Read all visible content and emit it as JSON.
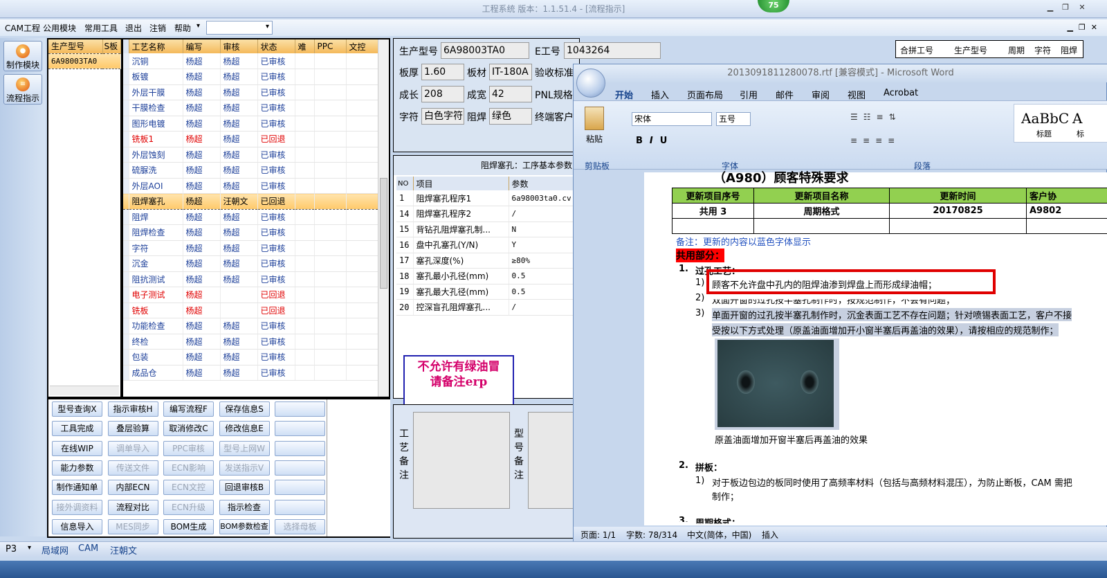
{
  "app": {
    "title": "工程系统  版本：1.1.51.4 - [流程指示]",
    "badge": "75"
  },
  "menu": {
    "items": [
      "CAM工程",
      "公用模块",
      "常用工具",
      "退出",
      "注销",
      "帮助"
    ],
    "dropdown_arrow": "▾",
    "combo_value": ""
  },
  "side_nav": [
    {
      "label": "制作模块"
    },
    {
      "label": "流程指示"
    }
  ],
  "model_list": {
    "headers": [
      "生产型号",
      "S板"
    ],
    "rows": [
      "6A98003TA0"
    ]
  },
  "process_grid": {
    "headers": [
      "工艺名称",
      "编写",
      "审核",
      "状态",
      "难",
      "PPC",
      "文控"
    ],
    "rows": [
      {
        "name": "沉铜",
        "writer": "杨超",
        "reviewer": "杨超",
        "status": "已审核",
        "red": false
      },
      {
        "name": "板镀",
        "writer": "杨超",
        "reviewer": "杨超",
        "status": "已审核",
        "red": false
      },
      {
        "name": "外层干膜",
        "writer": "杨超",
        "reviewer": "杨超",
        "status": "已审核",
        "red": false
      },
      {
        "name": "干膜检查",
        "writer": "杨超",
        "reviewer": "杨超",
        "status": "已审核",
        "red": false
      },
      {
        "name": "图形电镀",
        "writer": "杨超",
        "reviewer": "杨超",
        "status": "已审核",
        "red": false
      },
      {
        "name": "铣板1",
        "writer": "杨超",
        "reviewer": "杨超",
        "status": "已回退",
        "red": true
      },
      {
        "name": "外层蚀刻",
        "writer": "杨超",
        "reviewer": "杨超",
        "status": "已审核",
        "red": false
      },
      {
        "name": "硫脲洗",
        "writer": "杨超",
        "reviewer": "杨超",
        "status": "已审核",
        "red": false
      },
      {
        "name": "外层AOI",
        "writer": "杨超",
        "reviewer": "杨超",
        "status": "已审核",
        "red": false
      },
      {
        "name": "阻焊塞孔",
        "writer": "杨超",
        "reviewer": "汪朝文",
        "status": "已回退",
        "red": false,
        "selected": true
      },
      {
        "name": "阻焊",
        "writer": "杨超",
        "reviewer": "杨超",
        "status": "已审核",
        "red": false
      },
      {
        "name": "阻焊检查",
        "writer": "杨超",
        "reviewer": "杨超",
        "status": "已审核",
        "red": false
      },
      {
        "name": "字符",
        "writer": "杨超",
        "reviewer": "杨超",
        "status": "已审核",
        "red": false
      },
      {
        "name": "沉金",
        "writer": "杨超",
        "reviewer": "杨超",
        "status": "已审核",
        "red": false
      },
      {
        "name": "阻抗测试",
        "writer": "杨超",
        "reviewer": "杨超",
        "status": "已审核",
        "red": false
      },
      {
        "name": "电子测试",
        "writer": "杨超",
        "reviewer": "",
        "status": "已回退",
        "red": true
      },
      {
        "name": "铣板",
        "writer": "杨超",
        "reviewer": "",
        "status": "已回退",
        "red": true
      },
      {
        "name": "功能检查",
        "writer": "杨超",
        "reviewer": "杨超",
        "status": "已审核",
        "red": false
      },
      {
        "name": "终检",
        "writer": "杨超",
        "reviewer": "杨超",
        "status": "已审核",
        "red": false
      },
      {
        "name": "包装",
        "writer": "杨超",
        "reviewer": "杨超",
        "status": "已审核",
        "red": false
      },
      {
        "name": "成品仓",
        "writer": "杨超",
        "reviewer": "杨超",
        "status": "已审核",
        "red": false
      }
    ]
  },
  "buttons": [
    [
      "型号查询X",
      "指示审核H",
      "编写流程F",
      "保存信息S",
      ""
    ],
    [
      "工具完成",
      "叠层验算",
      "取消修改C",
      "修改信息E",
      ""
    ],
    [
      "在线WIP",
      "调单导入",
      "PPC审核",
      "型号上网W",
      ""
    ],
    [
      "能力参数",
      "传送文件",
      "ECN影响",
      "发送指示V",
      ""
    ],
    [
      "制作通知单",
      "内部ECN",
      "ECN文控",
      "回退审核B",
      ""
    ],
    [
      "接外调资料",
      "流程对比",
      "ECN升级",
      "指示检查",
      ""
    ],
    [
      "信息导入",
      "MES同步",
      "BOM生成",
      "BOM参数检查",
      "选择母板"
    ]
  ],
  "buttons_disabled": [
    "调单导入",
    "PPC审核",
    "型号上网W",
    "传送文件",
    "ECN影响",
    "发送指示V",
    "ECN文控",
    "接外调资料",
    "ECN升级",
    "MES同步",
    "选择母板"
  ],
  "form": {
    "model_label": "生产型号",
    "model_value": "6A98003TA0",
    "e_label": "E工号",
    "e_value": "1043264",
    "thick_label": "板厚",
    "thick_value": "1.60",
    "material_label": "板材",
    "material_value": "IT-180A",
    "accept_label": "验收标准",
    "grow_label": "成长",
    "grow_value": "208",
    "width_label": "成宽",
    "width_value": "42",
    "pnl_label": "PNL规格",
    "char_label": "字符",
    "char_value": "白色字符",
    "mask_label": "阻焊",
    "mask_value": "绿色",
    "terminal_label": "终端客户"
  },
  "right_grid_headers": [
    "合拼工号",
    "生产型号",
    "周期",
    "字符",
    "阻焊"
  ],
  "params": {
    "title": "阻焊塞孔：工序基本参数",
    "headers": [
      "NO",
      "项目",
      "参数"
    ],
    "rows": [
      {
        "no": "1",
        "item": "阻焊塞孔程序1",
        "value": "6a98003ta0.cv"
      },
      {
        "no": "14",
        "item": "阻焊塞孔程序2",
        "value": "/"
      },
      {
        "no": "15",
        "item": "背钻孔阻焊塞孔制...",
        "value": "N"
      },
      {
        "no": "16",
        "item": "盘中孔塞孔(Y/N)",
        "value": "Y"
      },
      {
        "no": "17",
        "item": "塞孔深度(%)",
        "value": "≥80%"
      },
      {
        "no": "18",
        "item": "塞孔最小孔径(mm)",
        "value": "0.5"
      },
      {
        "no": "19",
        "item": "塞孔最大孔径(mm)",
        "value": "0.5"
      },
      {
        "no": "20",
        "item": "控深盲孔阻焊塞孔...",
        "value": "/"
      }
    ]
  },
  "note_box": {
    "line1": "不允许有绿油冒",
    "line2": "请备注erp"
  },
  "remarks": {
    "process": "工艺备注",
    "model": "型号备注"
  },
  "statusbar": {
    "p3": "P3",
    "items": [
      "局域网",
      "CAM",
      "汪朝文"
    ]
  },
  "word": {
    "title": "2013091811280078.rtf [兼容模式] - Microsoft Word",
    "tabs": [
      "开始",
      "插入",
      "页面布局",
      "引用",
      "邮件",
      "审阅",
      "视图",
      "Acrobat"
    ],
    "font": "宋体",
    "size": "五号",
    "groups": [
      "剪贴板",
      "字体",
      "段落"
    ],
    "paste": "粘贴",
    "style1": "AaBbC",
    "style1_label": "标题",
    "style2": "A",
    "style2_label": "标",
    "doc_heading": "（A980）顾客特殊要求",
    "table_headers": [
      "更新项目序号",
      "更新项目名称",
      "更新时间",
      "客户协"
    ],
    "table_row": [
      "共用 3",
      "周期格式",
      "20170825",
      "A9802"
    ],
    "note": "备注：更新的内容以蓝色字体显示",
    "common": "共用部分：",
    "s1": "1.",
    "s1_title": "过孔工艺：",
    "item1": "顾客不允许盘中孔内的阻焊油渗到焊盘上而形成绿油帽；",
    "item2": "双面开窗的过孔按半塞孔制作时，按规范制作，不会有问题；",
    "item3a": "单面开窗的过孔按半塞孔制作时，沉金表面工艺不存在问题；针对喷锡表面工艺，客户不接",
    "item3b": "受按以下方式处理（原盖油面增加开小窗半塞后再盖油的效果），请按相应的规范制作；",
    "caption": "原盖油面增加开窗半塞后再盖油的效果",
    "s2": "2.",
    "s2_title": "拼板：",
    "item4a": "对于板边包边的板同时使用了高频率材料（包括与高频材料混压），为防止断板，CAM 需把",
    "item4b": "制作；",
    "s3": "3.",
    "s3_title": "周期格式：",
    "status_page": "页面: 1/1",
    "status_words": "字数: 78/314",
    "status_lang": "中文(简体，中国)",
    "status_mode": "插入"
  }
}
